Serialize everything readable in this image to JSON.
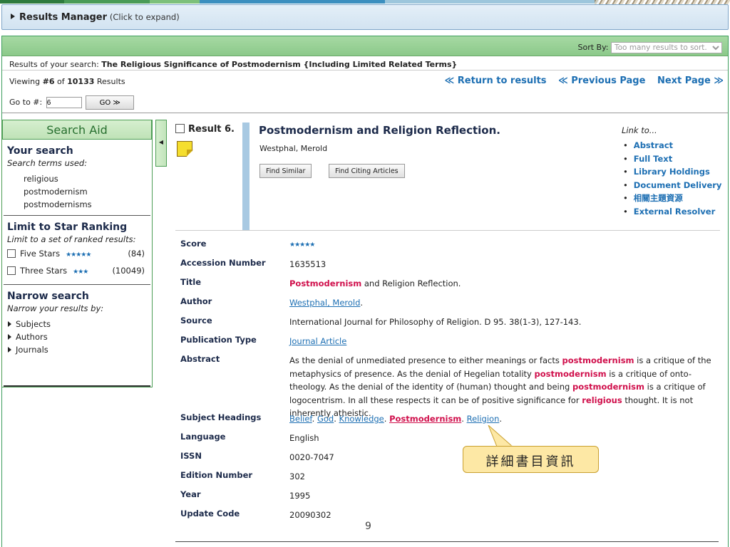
{
  "results_manager": {
    "label": "Results Manager",
    "hint": "(Click to expand)"
  },
  "sort": {
    "label": "Sort By:",
    "value": "Too many results to sort."
  },
  "search": {
    "prefix": "Results of your search:",
    "query": "The Religious Significance of Postmodernism {Including Limited Related Terms}"
  },
  "viewing": {
    "prefix": "Viewing",
    "num": "#6",
    "of": "of",
    "total": "10133",
    "suffix": "Results"
  },
  "goto": {
    "label": "Go to #:",
    "value": "6",
    "button": "GO ≫"
  },
  "nav": {
    "return": "≪ Return to results",
    "prev": "≪ Previous Page",
    "next": "Next Page ≫"
  },
  "search_aid": {
    "title": "Search Aid",
    "your_search": "Your search",
    "terms_label": "Search terms used:",
    "terms": [
      "religious",
      "postmodernism",
      "postmodernisms"
    ],
    "limit_title": "Limit to Star Ranking",
    "limit_sub": "Limit to a set of ranked results:",
    "star_rows": [
      {
        "label": "Five Stars",
        "stars": "★★★★★",
        "count": "(84)"
      },
      {
        "label": "Three Stars",
        "stars": "★★★",
        "count": "(10049)"
      }
    ],
    "narrow_title": "Narrow search",
    "narrow_sub": "Narrow your results by:",
    "narrow_items": [
      "Subjects",
      "Authors",
      "Journals"
    ]
  },
  "result": {
    "number": "Result 6.",
    "title": "Postmodernism and Religion Reflection.",
    "author": "Westphal, Merold",
    "buttons": {
      "similar": "Find Similar",
      "citing": "Find Citing Articles"
    },
    "link_to_label": "Link to...",
    "link_to": [
      "Abstract",
      "Full Text",
      "Library Holdings",
      "Document Delivery",
      "相關主題資源",
      "External Resolver"
    ]
  },
  "fields": {
    "score": {
      "key": "Score",
      "value": "★★★★★"
    },
    "accession": {
      "key": "Accession Number",
      "value": "1635513"
    },
    "title": {
      "key": "Title",
      "hl": "Postmodernism",
      "rest": " and Religion Reflection."
    },
    "author": {
      "key": "Author",
      "value": "Westphal, Merold",
      "trail": "."
    },
    "source": {
      "key": "Source",
      "value": "International Journal for Philosophy of Religion. D 95. 38(1-3), 127-143."
    },
    "pubtype": {
      "key": "Publication Type",
      "value": "Journal Article"
    },
    "abstract": {
      "key": "Abstract",
      "p1": "As the denial of unmediated presence to either meanings or facts ",
      "h1": "postmodernism",
      "p2": " is a critique of the metaphysics of presence. As the denial of Hegelian totality ",
      "h2": "postmodernism",
      "p3": " is a critique of onto-theology. As the denial of the identity of (human) thought and being ",
      "h3": "postmodernism",
      "p4": " is a critique of logocentrism. In all these respects it can be of positive significance for ",
      "h4": "religious",
      "p5": " thought. It is not inherently atheistic."
    },
    "subjects": {
      "key": "Subject Headings",
      "items": [
        "Belief",
        "God",
        "Knowledge",
        "Postmodernism",
        "Religion"
      ]
    },
    "language": {
      "key": "Language",
      "value": "English"
    },
    "issn": {
      "key": "ISSN",
      "value": "0020-7047"
    },
    "edition": {
      "key": "Edition Number",
      "value": "302"
    },
    "year": {
      "key": "Year",
      "value": "1995"
    },
    "update": {
      "key": "Update Code",
      "value": "20090302"
    }
  },
  "callout": "詳細書目資訊",
  "page_number": "9"
}
